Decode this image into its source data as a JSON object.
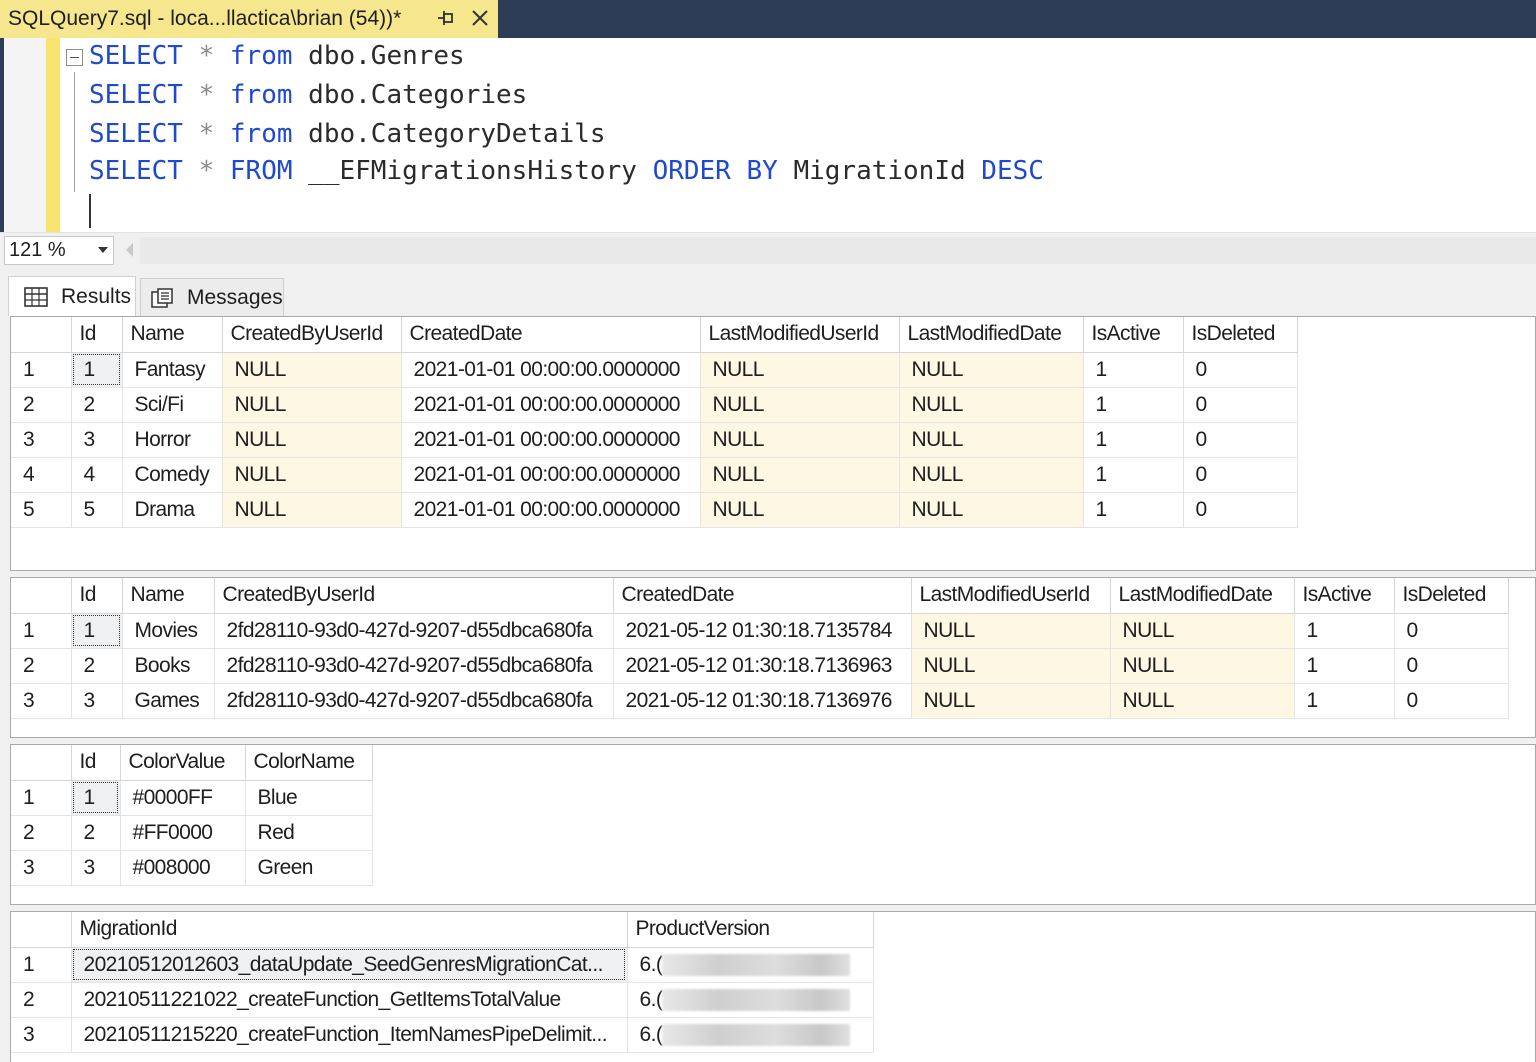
{
  "window": {
    "tab_title": "SQLQuery7.sql - loca...llactica\\brian (54))*"
  },
  "editor": {
    "lines": [
      {
        "k1": "SELECT",
        "op": "*",
        "k2": "from",
        "obj": "dbo.Genres",
        "rest": ""
      },
      {
        "k1": "SELECT",
        "op": "*",
        "k2": "from",
        "obj": "dbo.Categories",
        "rest": ""
      },
      {
        "k1": "SELECT",
        "op": "*",
        "k2": "from",
        "obj": "dbo.CategoryDetails",
        "rest": ""
      },
      {
        "k1": "SELECT",
        "op": "*",
        "k2": "FROM",
        "obj": "__EFMigrationsHistory",
        "k3": "ORDER BY",
        "obj2": "MigrationId",
        "k4": "DESC"
      }
    ]
  },
  "zoom": {
    "value": "121 %"
  },
  "result_tabs": {
    "results": "Results",
    "messages": "Messages"
  },
  "grids": [
    {
      "columns": [
        "Id",
        "Name",
        "CreatedByUserId",
        "CreatedDate",
        "LastModifiedUserId",
        "LastModifiedDate",
        "IsActive",
        "IsDeleted"
      ],
      "rows": [
        [
          "1",
          "1",
          "Fantasy",
          "NULL",
          "2021-01-01 00:00:00.0000000",
          "NULL",
          "NULL",
          "1",
          "0"
        ],
        [
          "2",
          "2",
          "Sci/Fi",
          "NULL",
          "2021-01-01 00:00:00.0000000",
          "NULL",
          "NULL",
          "1",
          "0"
        ],
        [
          "3",
          "3",
          "Horror",
          "NULL",
          "2021-01-01 00:00:00.0000000",
          "NULL",
          "NULL",
          "1",
          "0"
        ],
        [
          "4",
          "4",
          "Comedy",
          "NULL",
          "2021-01-01 00:00:00.0000000",
          "NULL",
          "NULL",
          "1",
          "0"
        ],
        [
          "5",
          "5",
          "Drama",
          "NULL",
          "2021-01-01 00:00:00.0000000",
          "NULL",
          "NULL",
          "1",
          "0"
        ]
      ]
    },
    {
      "columns": [
        "Id",
        "Name",
        "CreatedByUserId",
        "CreatedDate",
        "LastModifiedUserId",
        "LastModifiedDate",
        "IsActive",
        "IsDeleted"
      ],
      "rows": [
        [
          "1",
          "1",
          "Movies",
          "2fd28110-93d0-427d-9207-d55dbca680fa",
          "2021-05-12 01:30:18.7135784",
          "NULL",
          "NULL",
          "1",
          "0"
        ],
        [
          "2",
          "2",
          "Books",
          "2fd28110-93d0-427d-9207-d55dbca680fa",
          "2021-05-12 01:30:18.7136963",
          "NULL",
          "NULL",
          "1",
          "0"
        ],
        [
          "3",
          "3",
          "Games",
          "2fd28110-93d0-427d-9207-d55dbca680fa",
          "2021-05-12 01:30:18.7136976",
          "NULL",
          "NULL",
          "1",
          "0"
        ]
      ]
    },
    {
      "columns": [
        "Id",
        "ColorValue",
        "ColorName"
      ],
      "rows": [
        [
          "1",
          "1",
          "#0000FF",
          "Blue"
        ],
        [
          "2",
          "2",
          "#FF0000",
          "Red"
        ],
        [
          "3",
          "3",
          "#008000",
          "Green"
        ]
      ]
    },
    {
      "columns": [
        "MigrationId",
        "ProductVersion"
      ],
      "rows": [
        [
          "1",
          "20210512012603_dataUpdate_SeedGenresMigrationCat...",
          "6.("
        ],
        [
          "2",
          "20210511221022_createFunction_GetItemsTotalValue",
          "6.("
        ],
        [
          "3",
          "20210511215220_createFunction_ItemNamesPipeDelimit...",
          "6.("
        ]
      ]
    }
  ]
}
